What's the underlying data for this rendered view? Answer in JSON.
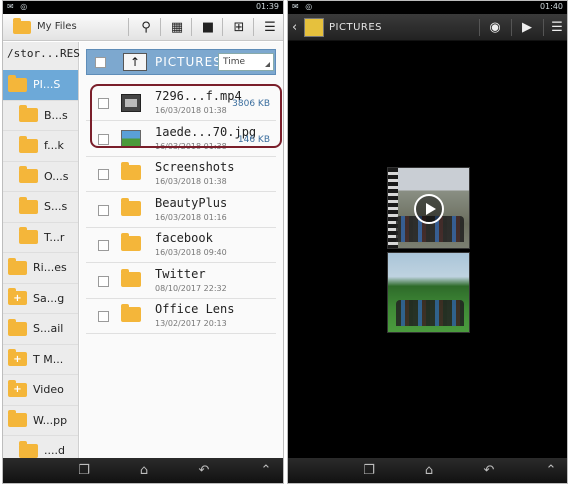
{
  "left": {
    "status": {
      "time": "01:39"
    },
    "toolbar": {
      "title": "My Files"
    },
    "sidebar": {
      "path": "/stor...RES",
      "items": [
        {
          "label": "PI...S",
          "active": true,
          "indent": false,
          "plus": false
        },
        {
          "label": "B...s",
          "indent": true,
          "plus": false
        },
        {
          "label": "f...k",
          "indent": true,
          "plus": false
        },
        {
          "label": "O...s",
          "indent": true,
          "plus": false
        },
        {
          "label": "S...s",
          "indent": true,
          "plus": false
        },
        {
          "label": "T...r",
          "indent": true,
          "plus": false
        },
        {
          "label": "Ri...es",
          "indent": false,
          "plus": false
        },
        {
          "label": "Sa...g",
          "indent": false,
          "plus": true
        },
        {
          "label": "S...ail",
          "indent": false,
          "plus": false
        },
        {
          "label": "T M...",
          "indent": false,
          "plus": true
        },
        {
          "label": "Video",
          "indent": false,
          "plus": true
        },
        {
          "label": "W...pp",
          "indent": false,
          "plus": false
        },
        {
          "label": "....d",
          "indent": true,
          "plus": false
        }
      ]
    },
    "list": {
      "header_title": "PICTURES",
      "sort_value": "Time",
      "up_icon": "↑",
      "files": [
        {
          "name": "7296...f.mp4",
          "date": "16/03/2018 01:38",
          "size": "3806 KB",
          "type": "video"
        },
        {
          "name": "1aede...70.jpg",
          "date": "16/03/2018 01:38",
          "size": "146 KB",
          "type": "image"
        },
        {
          "name": "Screenshots",
          "date": "16/03/2018 01:38",
          "size": "",
          "type": "folder"
        },
        {
          "name": "BeautyPlus",
          "date": "16/03/2018 01:16",
          "size": "",
          "type": "folder"
        },
        {
          "name": "facebook",
          "date": "16/03/2018 09:40",
          "size": "",
          "type": "folder"
        },
        {
          "name": "Twitter",
          "date": "08/10/2017 22:32",
          "size": "",
          "type": "folder"
        },
        {
          "name": "Office Lens",
          "date": "13/02/2017 20:13",
          "size": "",
          "type": "folder"
        }
      ]
    }
  },
  "right": {
    "status": {
      "time": "01:40"
    },
    "toolbar": {
      "title": "PICTURES"
    }
  },
  "colors": {
    "accent": "#7da8cf",
    "folder": "#f4b63a",
    "selection_border": "#7a1e2a",
    "size_text": "#3b6e9e"
  }
}
